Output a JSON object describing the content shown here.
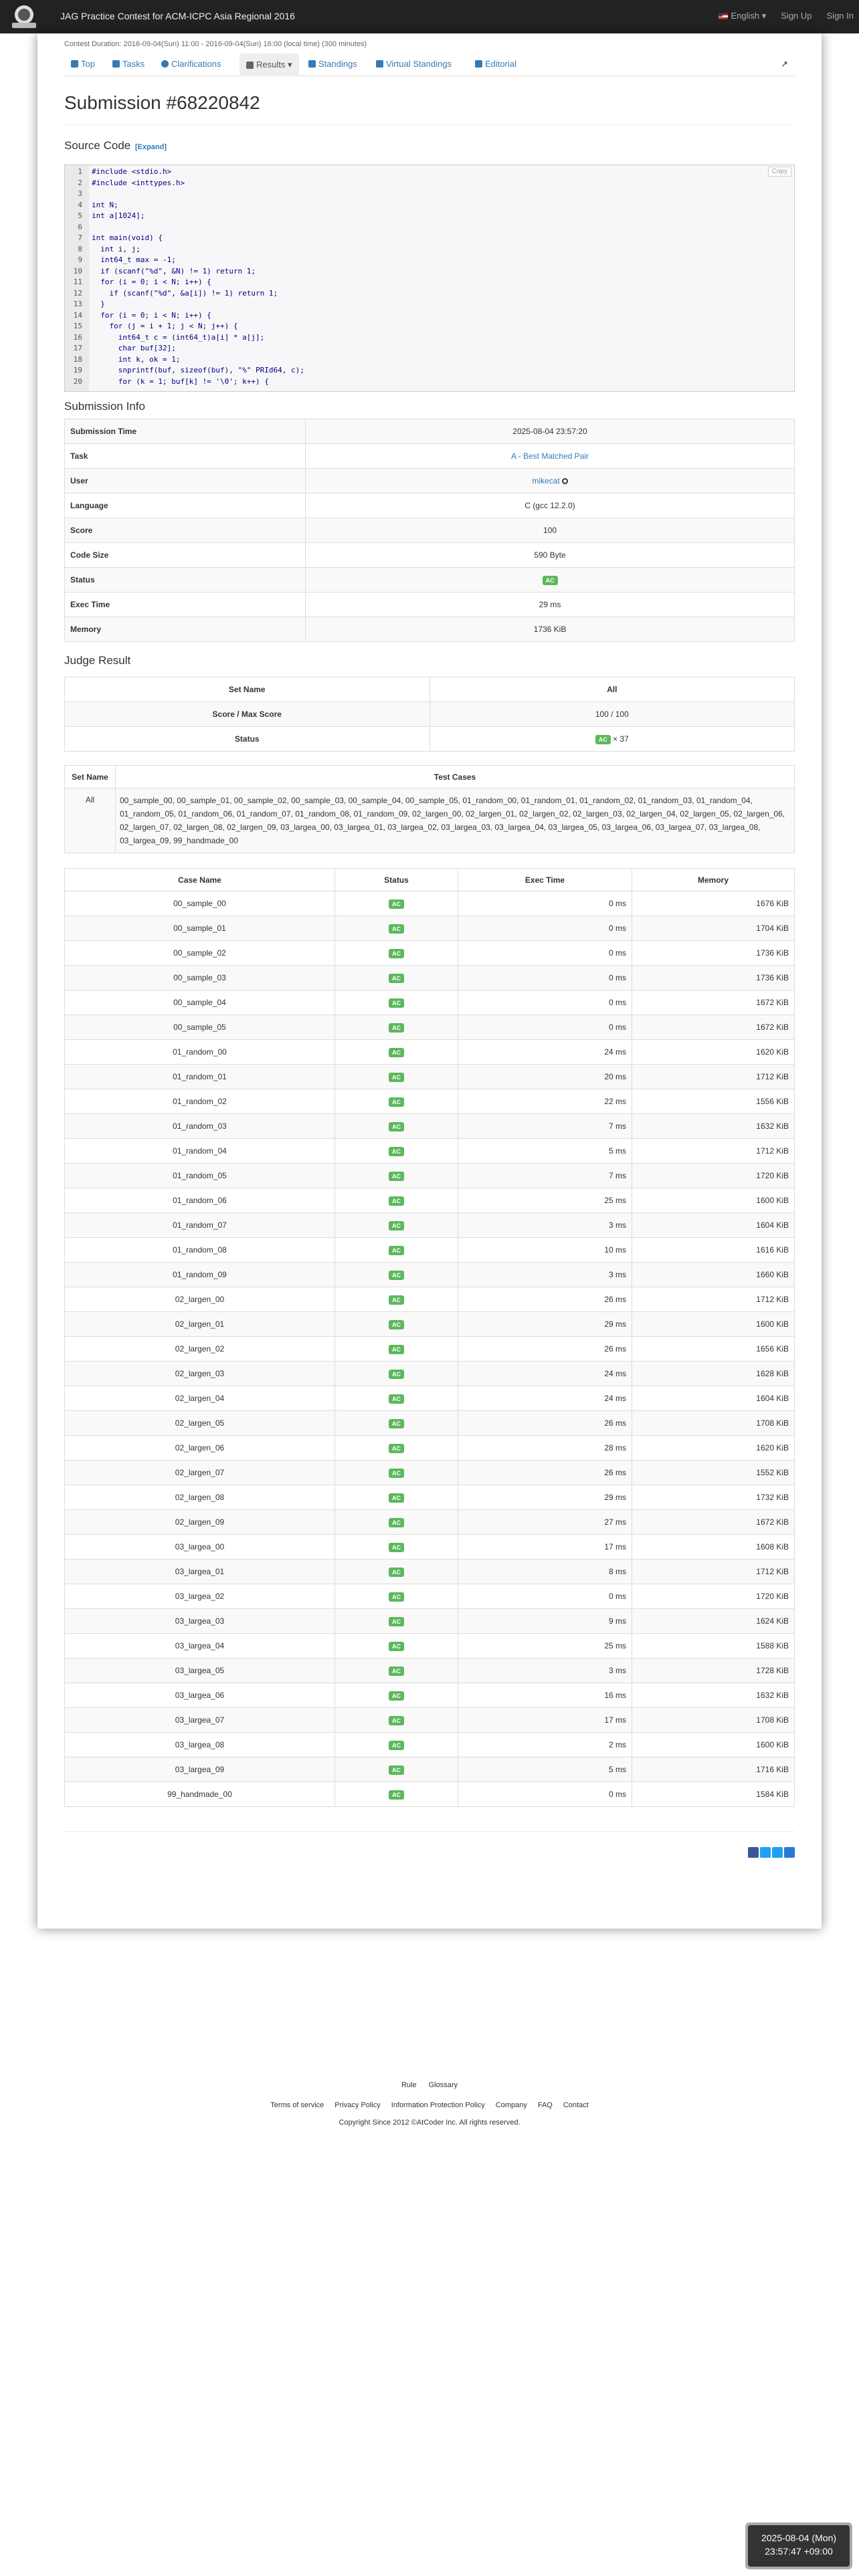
{
  "nav": {
    "site_title": "JAG Practice Contest for ACM-ICPC Asia Regional 2016",
    "language": "English ▾",
    "sign_up": "Sign Up",
    "sign_in": "Sign In"
  },
  "contest": {
    "duration": "Contest Duration: 2016-09-04(Sun) 11:00 - 2016-09-04(Sun) 16:00 (local time) (300 minutes)"
  },
  "tabs": {
    "top": "Top",
    "tasks": "Tasks",
    "clarifications": "Clarifications",
    "results": "Results ▾",
    "standings": "Standings",
    "virtual_standings": "Virtual Standings",
    "editorial": "Editorial"
  },
  "submission": {
    "title": "Submission #68220842"
  },
  "source": {
    "heading": "Source Code",
    "expand": "[Expand]",
    "copy": "Copy",
    "lines": [
      "#include <stdio.h>",
      "#include <inttypes.h>",
      "",
      "int N;",
      "int a[1024];",
      "",
      "int main(void) {",
      "  int i, j;",
      "  int64_t max = -1;",
      "  if (scanf(\"%d\", &N) != 1) return 1;",
      "  for (i = 0; i < N; i++) {",
      "    if (scanf(\"%d\", &a[i]) != 1) return 1;",
      "  }",
      "  for (i = 0; i < N; i++) {",
      "    for (j = i + 1; j < N; j++) {",
      "      int64_t c = (int64_t)a[i] * a[j];",
      "      char buf[32];",
      "      int k, ok = 1;",
      "      snprintf(buf, sizeof(buf), \"%\" PRId64, c);",
      "      for (k = 1; buf[k] != '\\0'; k++) {"
    ]
  },
  "info": {
    "heading": "Submission Info",
    "rows": [
      {
        "label": "Submission Time",
        "value": "2025-08-04 23:57:20"
      },
      {
        "label": "Task",
        "value": "A - Best Matched Pair"
      },
      {
        "label": "User",
        "value": "mikecat"
      },
      {
        "label": "Language",
        "value": "C (gcc 12.2.0)"
      },
      {
        "label": "Score",
        "value": "100"
      },
      {
        "label": "Code Size",
        "value": "590 Byte"
      },
      {
        "label": "Status",
        "value": "AC"
      },
      {
        "label": "Exec Time",
        "value": "29 ms"
      },
      {
        "label": "Memory",
        "value": "1736 KiB"
      }
    ]
  },
  "judge": {
    "heading": "Judge Result",
    "set_name_label": "Set Name",
    "set_name_value": "All",
    "score_label": "Score / Max Score",
    "score_value": "100 / 100",
    "status_label": "Status",
    "status_badge": "AC",
    "status_count": "× 37"
  },
  "sets": {
    "set_name_header": "Set Name",
    "test_cases_header": "Test Cases",
    "set_name": "All",
    "test_cases": "00_sample_00, 00_sample_01, 00_sample_02, 00_sample_03, 00_sample_04, 00_sample_05, 01_random_00, 01_random_01, 01_random_02, 01_random_03, 01_random_04, 01_random_05, 01_random_06, 01_random_07, 01_random_08, 01_random_09, 02_largen_00, 02_largen_01, 02_largen_02, 02_largen_03, 02_largen_04, 02_largen_05, 02_largen_06, 02_largen_07, 02_largen_08, 02_largen_09, 03_largea_00, 03_largea_01, 03_largea_02, 03_largea_03, 03_largea_04, 03_largea_05, 03_largea_06, 03_largea_07, 03_largea_08, 03_largea_09, 99_handmade_00"
  },
  "cases": {
    "headers": [
      "Case Name",
      "Status",
      "Exec Time",
      "Memory"
    ],
    "rows": [
      [
        "00_sample_00",
        "AC",
        "0 ms",
        "1676 KiB"
      ],
      [
        "00_sample_01",
        "AC",
        "0 ms",
        "1704 KiB"
      ],
      [
        "00_sample_02",
        "AC",
        "0 ms",
        "1736 KiB"
      ],
      [
        "00_sample_03",
        "AC",
        "0 ms",
        "1736 KiB"
      ],
      [
        "00_sample_04",
        "AC",
        "0 ms",
        "1672 KiB"
      ],
      [
        "00_sample_05",
        "AC",
        "0 ms",
        "1672 KiB"
      ],
      [
        "01_random_00",
        "AC",
        "24 ms",
        "1620 KiB"
      ],
      [
        "01_random_01",
        "AC",
        "20 ms",
        "1712 KiB"
      ],
      [
        "01_random_02",
        "AC",
        "22 ms",
        "1556 KiB"
      ],
      [
        "01_random_03",
        "AC",
        "7 ms",
        "1632 KiB"
      ],
      [
        "01_random_04",
        "AC",
        "5 ms",
        "1712 KiB"
      ],
      [
        "01_random_05",
        "AC",
        "7 ms",
        "1720 KiB"
      ],
      [
        "01_random_06",
        "AC",
        "25 ms",
        "1600 KiB"
      ],
      [
        "01_random_07",
        "AC",
        "3 ms",
        "1604 KiB"
      ],
      [
        "01_random_08",
        "AC",
        "10 ms",
        "1616 KiB"
      ],
      [
        "01_random_09",
        "AC",
        "3 ms",
        "1660 KiB"
      ],
      [
        "02_largen_00",
        "AC",
        "26 ms",
        "1712 KiB"
      ],
      [
        "02_largen_01",
        "AC",
        "29 ms",
        "1600 KiB"
      ],
      [
        "02_largen_02",
        "AC",
        "26 ms",
        "1656 KiB"
      ],
      [
        "02_largen_03",
        "AC",
        "24 ms",
        "1628 KiB"
      ],
      [
        "02_largen_04",
        "AC",
        "24 ms",
        "1604 KiB"
      ],
      [
        "02_largen_05",
        "AC",
        "26 ms",
        "1708 KiB"
      ],
      [
        "02_largen_06",
        "AC",
        "28 ms",
        "1620 KiB"
      ],
      [
        "02_largen_07",
        "AC",
        "26 ms",
        "1552 KiB"
      ],
      [
        "02_largen_08",
        "AC",
        "29 ms",
        "1732 KiB"
      ],
      [
        "02_largen_09",
        "AC",
        "27 ms",
        "1672 KiB"
      ],
      [
        "03_largea_00",
        "AC",
        "17 ms",
        "1608 KiB"
      ],
      [
        "03_largea_01",
        "AC",
        "8 ms",
        "1712 KiB"
      ],
      [
        "03_largea_02",
        "AC",
        "0 ms",
        "1720 KiB"
      ],
      [
        "03_largea_03",
        "AC",
        "9 ms",
        "1624 KiB"
      ],
      [
        "03_largea_04",
        "AC",
        "25 ms",
        "1588 KiB"
      ],
      [
        "03_largea_05",
        "AC",
        "3 ms",
        "1728 KiB"
      ],
      [
        "03_largea_06",
        "AC",
        "16 ms",
        "1632 KiB"
      ],
      [
        "03_largea_07",
        "AC",
        "17 ms",
        "1708 KiB"
      ],
      [
        "03_largea_08",
        "AC",
        "2 ms",
        "1600 KiB"
      ],
      [
        "03_largea_09",
        "AC",
        "5 ms",
        "1716 KiB"
      ],
      [
        "99_handmade_00",
        "AC",
        "0 ms",
        "1584 KiB"
      ]
    ]
  },
  "footer": {
    "links1": [
      "Rule",
      "Glossary"
    ],
    "links2": [
      "Terms of service",
      "Privacy Policy",
      "Information Protection Policy",
      "Company",
      "FAQ",
      "Contact"
    ],
    "copyright": "Copyright Since 2012 ©AtCoder Inc. All rights reserved."
  },
  "clock": {
    "date": "2025-08-04 (Mon)",
    "time": "23:57:47 +09:00"
  },
  "colors": {
    "navbar": "#222222",
    "link": "#337ab7",
    "ac_badge": "#5cb85c"
  }
}
